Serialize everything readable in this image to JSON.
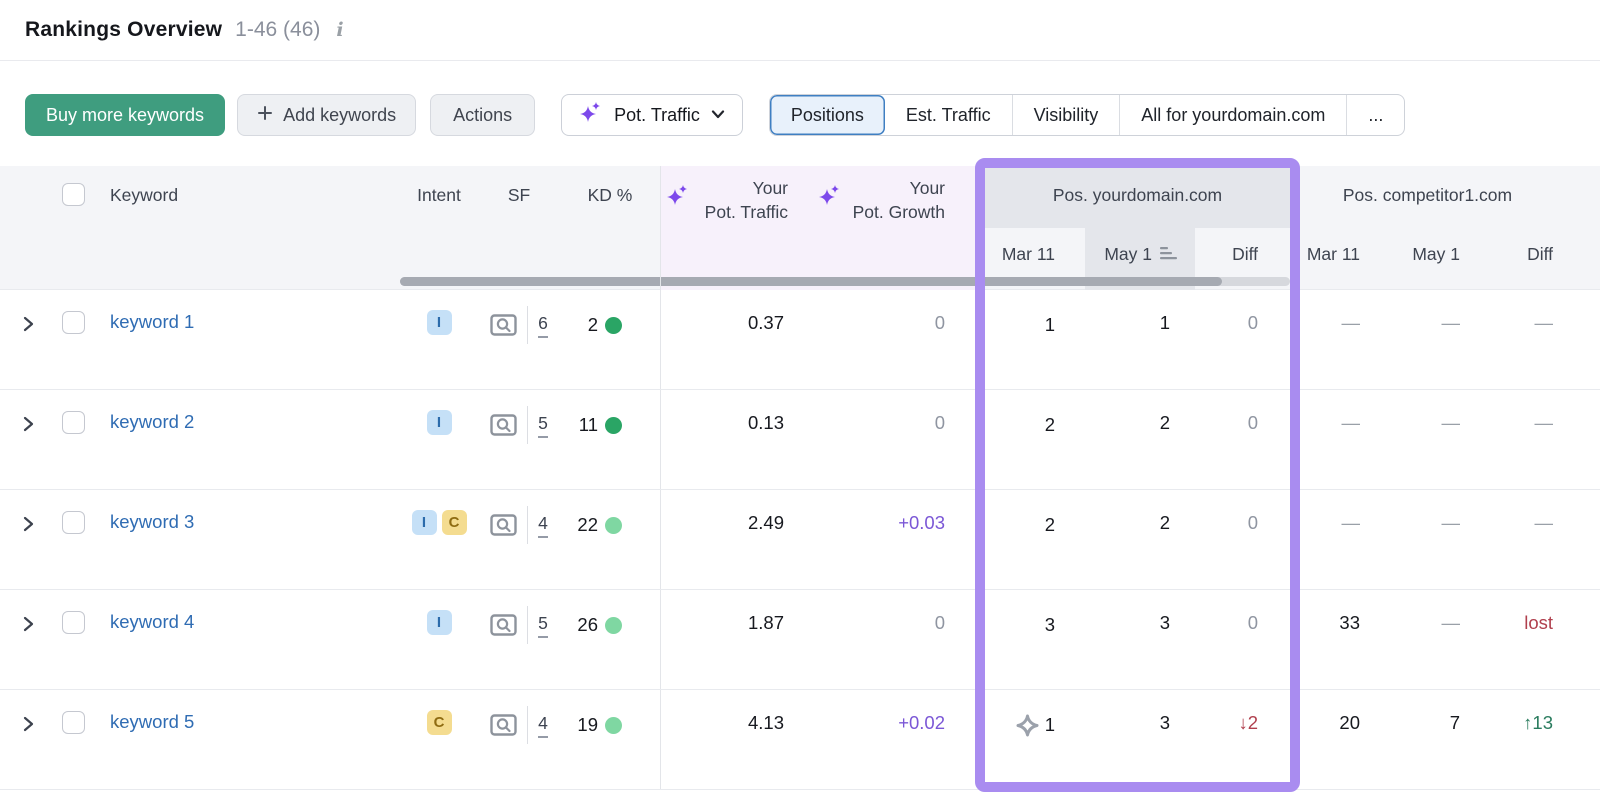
{
  "colors": {
    "primary_button_green": "#3f9d7f",
    "highlight_box_purple": "#a98cf0",
    "ai_sparkle_purple": "#7d49eb",
    "growth_purple": "#7b57d6",
    "link_blue": "#2f6cb3",
    "selected_tab_blue": "#3f7fc2",
    "negative_red": "#b03f4d",
    "positive_green": "#2a7c5e",
    "kd_dot_dark_green": "#2aa565",
    "kd_dot_light_green": "#7fd7a2",
    "intent_informational_bg": "#c5e0f7",
    "intent_commercial_bg": "#f4dc90"
  },
  "title": {
    "text": "Rankings Overview",
    "range": "1-46 (46)"
  },
  "toolbar": {
    "buy_label": "Buy more keywords",
    "add_label": "Add keywords",
    "actions_label": "Actions",
    "metric_dropdown_label": "Pot. Traffic",
    "tabs": [
      {
        "label": "Positions",
        "selected": true
      },
      {
        "label": "Est. Traffic",
        "selected": false
      },
      {
        "label": "Visibility",
        "selected": false
      },
      {
        "label": "All for yourdomain.com",
        "selected": false
      },
      {
        "label": "...",
        "selected": false
      }
    ]
  },
  "table": {
    "headers": {
      "keyword": "Keyword",
      "intent": "Intent",
      "sf": "SF",
      "kd": "KD %",
      "pot_traffic_l1": "Your",
      "pot_traffic_l2": "Pot. Traffic",
      "pot_growth_l1": "Your",
      "pot_growth_l2": "Pot. Growth",
      "group_yourdomain": "Pos. yourdomain.com",
      "group_competitor": "Pos. competitor1.com",
      "sub": {
        "mar": "Mar 11",
        "may": "May 1",
        "diff": "Diff"
      }
    },
    "rows": [
      {
        "keyword": "keyword 1",
        "intents": [
          "I"
        ],
        "sf": "6",
        "kd": "2",
        "kd_level": "dark",
        "pot_traffic": "0.37",
        "pot_growth": {
          "t": "0",
          "s": "muted"
        },
        "your_mar": {
          "t": "1",
          "star": false
        },
        "your_may": {
          "t": "1"
        },
        "your_diff": {
          "t": "0",
          "s": "muted"
        },
        "comp_mar": {
          "t": "—",
          "s": "dash"
        },
        "comp_may": {
          "t": "—",
          "s": "dash"
        },
        "comp_diff": {
          "t": "—",
          "s": "dash"
        }
      },
      {
        "keyword": "keyword 2",
        "intents": [
          "I"
        ],
        "sf": "5",
        "kd": "11",
        "kd_level": "dark",
        "pot_traffic": "0.13",
        "pot_growth": {
          "t": "0",
          "s": "muted"
        },
        "your_mar": {
          "t": "2",
          "star": false
        },
        "your_may": {
          "t": "2"
        },
        "your_diff": {
          "t": "0",
          "s": "muted"
        },
        "comp_mar": {
          "t": "—",
          "s": "dash"
        },
        "comp_may": {
          "t": "—",
          "s": "dash"
        },
        "comp_diff": {
          "t": "—",
          "s": "dash"
        }
      },
      {
        "keyword": "keyword 3",
        "intents": [
          "I",
          "C"
        ],
        "sf": "4",
        "kd": "22",
        "kd_level": "light",
        "pot_traffic": "2.49",
        "pot_growth": {
          "t": "+0.03",
          "s": "plus"
        },
        "your_mar": {
          "t": "2",
          "star": false
        },
        "your_may": {
          "t": "2"
        },
        "your_diff": {
          "t": "0",
          "s": "muted"
        },
        "comp_mar": {
          "t": "—",
          "s": "dash"
        },
        "comp_may": {
          "t": "—",
          "s": "dash"
        },
        "comp_diff": {
          "t": "—",
          "s": "dash"
        }
      },
      {
        "keyword": "keyword 4",
        "intents": [
          "I"
        ],
        "sf": "5",
        "kd": "26",
        "kd_level": "light",
        "pot_traffic": "1.87",
        "pot_growth": {
          "t": "0",
          "s": "muted"
        },
        "your_mar": {
          "t": "3",
          "star": false
        },
        "your_may": {
          "t": "3"
        },
        "your_diff": {
          "t": "0",
          "s": "muted"
        },
        "comp_mar": {
          "t": "33",
          "s": "num"
        },
        "comp_may": {
          "t": "—",
          "s": "dash"
        },
        "comp_diff": {
          "t": "lost",
          "s": "down"
        }
      },
      {
        "keyword": "keyword 5",
        "intents": [
          "C"
        ],
        "sf": "4",
        "kd": "19",
        "kd_level": "light",
        "pot_traffic": "4.13",
        "pot_growth": {
          "t": "+0.02",
          "s": "plus"
        },
        "your_mar": {
          "t": "1",
          "star": true
        },
        "your_may": {
          "t": "3"
        },
        "your_diff": {
          "t": "↓2",
          "s": "down"
        },
        "comp_mar": {
          "t": "20",
          "s": "num"
        },
        "comp_may": {
          "t": "7",
          "s": "num"
        },
        "comp_diff": {
          "t": "↑13",
          "s": "up"
        }
      }
    ]
  }
}
